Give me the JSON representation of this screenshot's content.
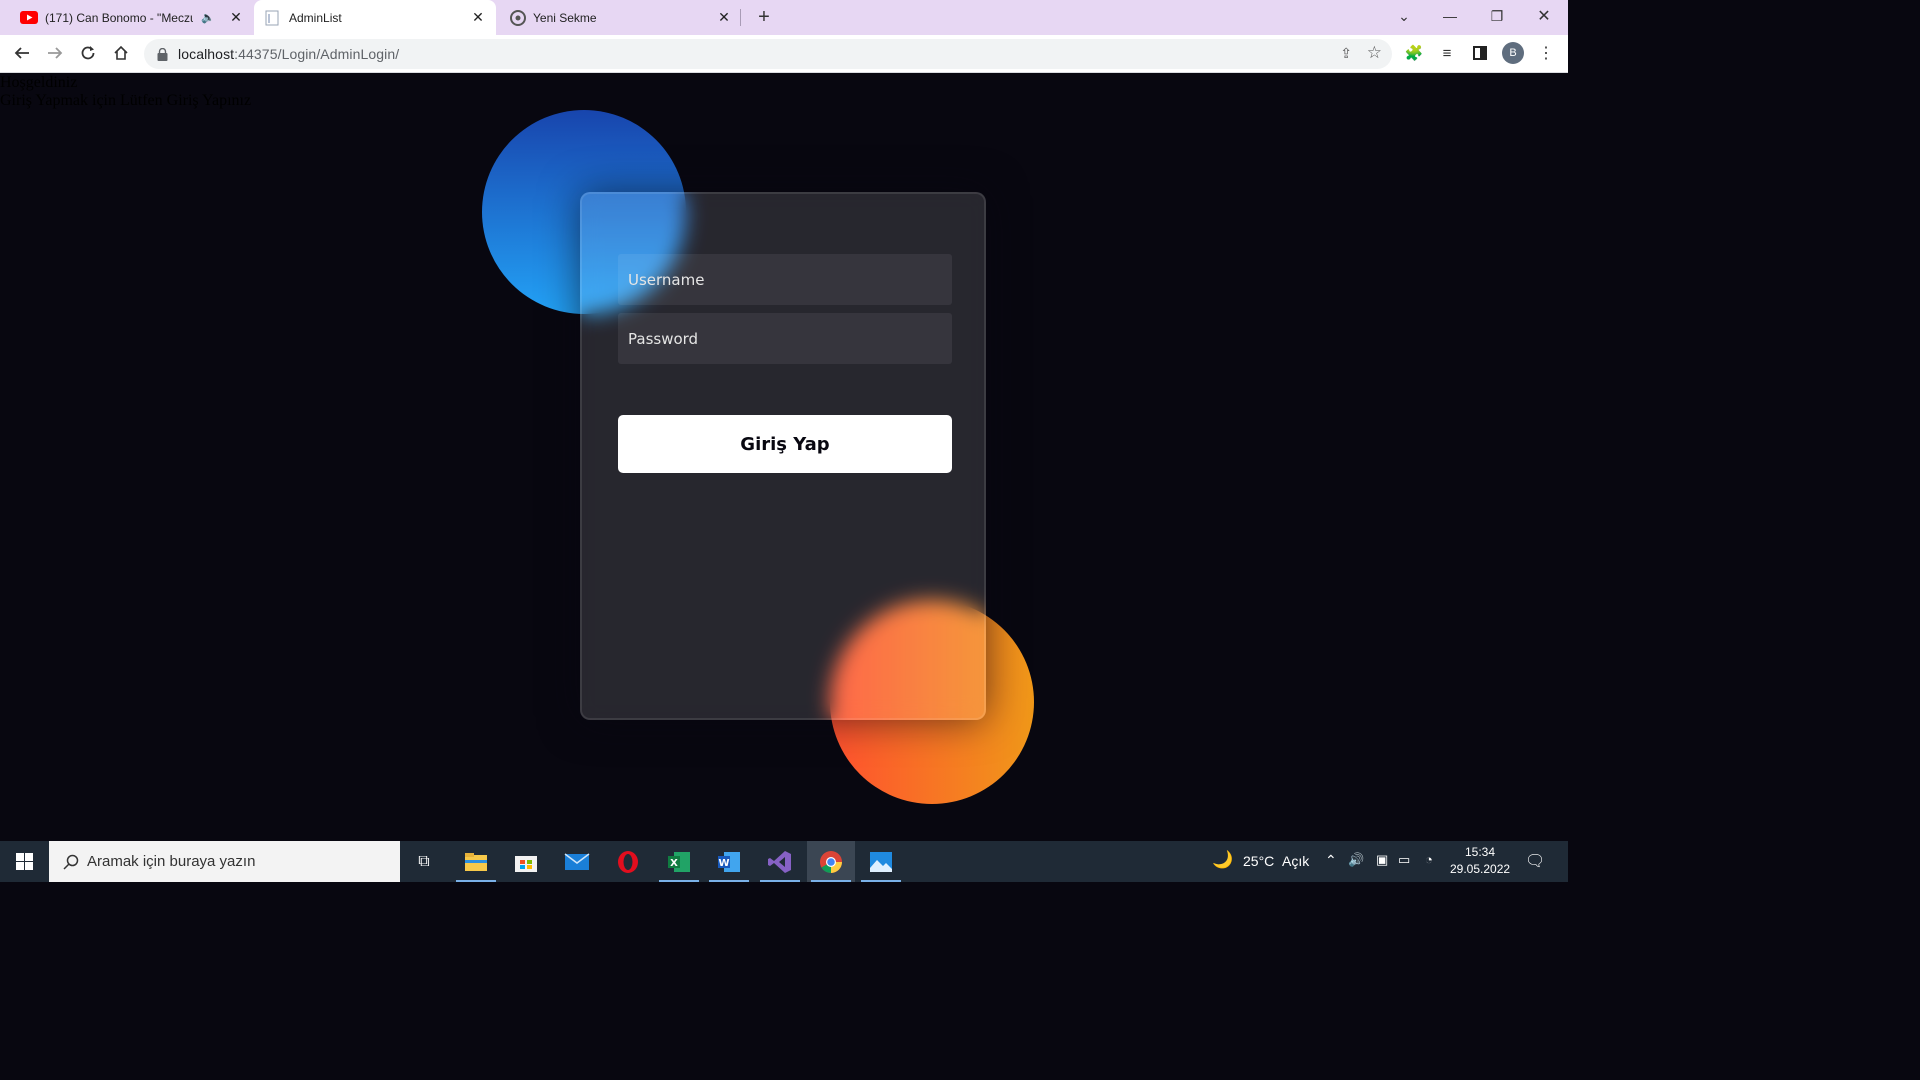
{
  "browser": {
    "tabs": [
      {
        "label": "(171) Can Bonomo - \"Meczup",
        "icon": "youtube-icon",
        "audio": true
      },
      {
        "label": "AdminList",
        "icon": "page-icon",
        "active": true
      },
      {
        "label": "Yeni Sekme",
        "icon": "chrome-icon"
      }
    ],
    "url_host": "localhost",
    "url_path": ":44375/Login/AdminLogin/",
    "profile_initial": "B"
  },
  "page": {
    "welcome": "Hoşgeldiniz",
    "instruction": "Giriş Yapmak için Lütfen Giriş Yapınız",
    "username_placeholder": "Username",
    "password_placeholder": "Password",
    "login_button": "Giriş Yap"
  },
  "taskbar": {
    "search_placeholder": "Aramak için buraya yazın",
    "weather": "25°C",
    "weather_condition": "Açık",
    "time": "15:34",
    "date": "29.05.2022"
  },
  "colors": {
    "page_bg": "#080710",
    "blue_gradient": [
      "#1845ad",
      "#23a2f6"
    ],
    "orange_gradient": [
      "#ff512f",
      "#f09819"
    ],
    "tabstrip": "#e7d7f3"
  }
}
